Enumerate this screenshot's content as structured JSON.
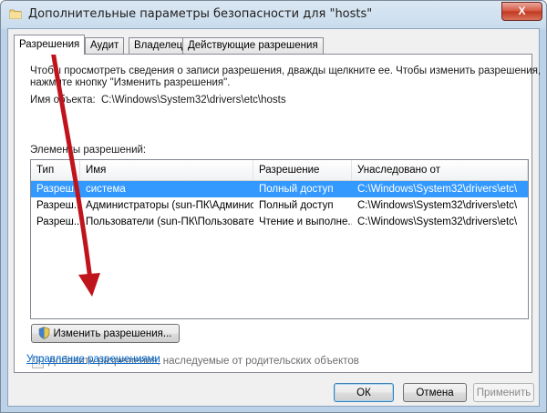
{
  "window": {
    "title": "Дополнительные параметры безопасности  для \"hosts\"",
    "close_label": "X"
  },
  "tabs": [
    {
      "label": "Разрешения",
      "active": true
    },
    {
      "label": "Аудит",
      "active": false
    },
    {
      "label": "Владелец",
      "active": false
    },
    {
      "label": "Действующие разрешения",
      "active": false
    }
  ],
  "permissions": {
    "hint_line1": "Чтобы просмотреть сведения о записи разрешения, дважды щелкните ее. Чтобы изменить разрешения,",
    "hint_line2": "нажмите кнопку \"Изменить разрешения\".",
    "object_label": "Имя объекта:",
    "object_value": "C:\\Windows\\System32\\drivers\\etc\\hosts",
    "entries_label": "Элементы разрешений:",
    "columns": [
      "Тип",
      "Имя",
      "Разрешение",
      "Унаследовано от"
    ],
    "rows": [
      {
        "type": "Разреш...",
        "name": "система",
        "permission": "Полный доступ",
        "inherited": "C:\\Windows\\System32\\drivers\\etc\\",
        "selected": true
      },
      {
        "type": "Разреш...",
        "name": "Администраторы (sun-ПК\\Админис...",
        "permission": "Полный доступ",
        "inherited": "C:\\Windows\\System32\\drivers\\etc\\",
        "selected": false
      },
      {
        "type": "Разреш...",
        "name": "Пользователи (sun-ПК\\Пользовате...",
        "permission": "Чтение и выполне...",
        "inherited": "C:\\Windows\\System32\\drivers\\etc\\",
        "selected": false
      }
    ],
    "change_button": "Изменить разрешения...",
    "inherit_checkbox_label": "Добавить разрешения, наследуемые от родительских объектов",
    "inherit_checked": true,
    "manage_link": "Управление разрешениями"
  },
  "footer": {
    "ok": "ОК",
    "cancel": "Отмена",
    "apply": "Применить"
  },
  "colors": {
    "selection": "#3399ff",
    "annotation_arrow": "#c0141c"
  }
}
